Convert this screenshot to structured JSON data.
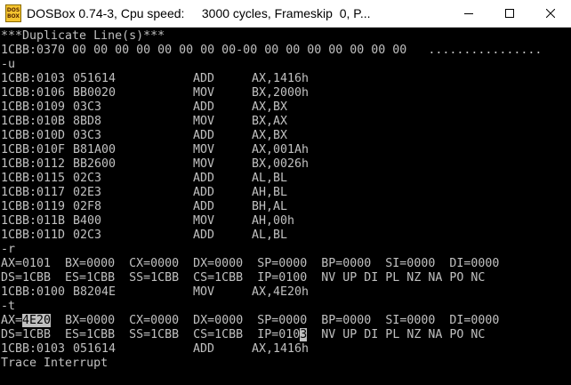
{
  "window": {
    "icon_text_1": "DOS",
    "icon_text_2": "BOX",
    "title": "DOSBox 0.74-3, Cpu speed:     3000 cycles, Frameskip  0, P..."
  },
  "console": {
    "header": "***Duplicate Line(s)***",
    "dump_line": "1CBB:0370 00 00 00 00 00 00 00 00-00 00 00 00 00 00 00 00   ................",
    "cmd_u": "-u",
    "disasm": [
      {
        "addr": "1CBB:0103",
        "hex": "051614",
        "mn": "ADD",
        "op": "AX,1416h"
      },
      {
        "addr": "1CBB:0106",
        "hex": "BB0020",
        "mn": "MOV",
        "op": "BX,2000h"
      },
      {
        "addr": "1CBB:0109",
        "hex": "03C3",
        "mn": "ADD",
        "op": "AX,BX"
      },
      {
        "addr": "1CBB:010B",
        "hex": "8BD8",
        "mn": "MOV",
        "op": "BX,AX"
      },
      {
        "addr": "1CBB:010D",
        "hex": "03C3",
        "mn": "ADD",
        "op": "AX,BX"
      },
      {
        "addr": "1CBB:010F",
        "hex": "B81A00",
        "mn": "MOV",
        "op": "AX,001Ah"
      },
      {
        "addr": "1CBB:0112",
        "hex": "BB2600",
        "mn": "MOV",
        "op": "BX,0026h"
      },
      {
        "addr": "1CBB:0115",
        "hex": "02C3",
        "mn": "ADD",
        "op": "AL,BL"
      },
      {
        "addr": "1CBB:0117",
        "hex": "02E3",
        "mn": "ADD",
        "op": "AH,BL"
      },
      {
        "addr": "1CBB:0119",
        "hex": "02F8",
        "mn": "ADD",
        "op": "BH,AL"
      },
      {
        "addr": "1CBB:011B",
        "hex": "B400",
        "mn": "MOV",
        "op": "AH,00h"
      },
      {
        "addr": "1CBB:011D",
        "hex": "02C3",
        "mn": "ADD",
        "op": "AL,BL"
      }
    ],
    "cmd_r": "-r",
    "r_regs1": "AX=0101  BX=0000  CX=0000  DX=0000  SP=0000  BP=0000  SI=0000  DI=0000",
    "r_regs2": "DS=1CBB  ES=1CBB  SS=1CBB  CS=1CBB  IP=0100  NV UP DI PL NZ NA PO NC",
    "r_next": {
      "addr": "1CBB:0100",
      "hex": "B8204E",
      "mn": "MOV",
      "op": "AX,4E20h"
    },
    "cmd_t": "-t",
    "t_ax_label": "AX=",
    "t_ax_value": "4E20",
    "t_regs1_rest": "  BX=0000  CX=0000  DX=0000  SP=0000  BP=0000  SI=0000  DI=0000",
    "t_regs2_pre": "DS=1CBB  ES=1CBB  SS=1CBB  CS=1CBB  IP=010",
    "t_regs2_cursor": "3",
    "t_regs2_post": "  NV UP DI PL NZ NA PO NC",
    "t_next": {
      "addr": "1CBB:0103",
      "hex": "051614",
      "mn": "ADD",
      "op": "AX,1416h"
    },
    "trace_msg": "Trace Interrupt"
  }
}
